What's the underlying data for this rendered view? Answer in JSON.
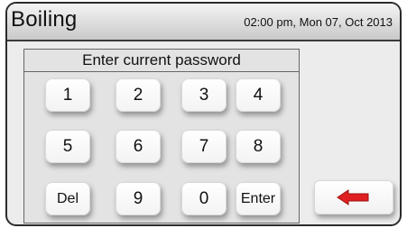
{
  "header": {
    "title": "Boiling",
    "datetime": "02:00 pm, Mon 07, Oct 2013"
  },
  "keypad": {
    "prompt": "Enter current password",
    "keys": [
      "1",
      "2",
      "3",
      "4",
      "5",
      "6",
      "7",
      "8",
      "Del",
      "9",
      "0",
      "Enter"
    ]
  },
  "back_button": {
    "icon": "left-arrow-icon",
    "color": "#e02020"
  }
}
